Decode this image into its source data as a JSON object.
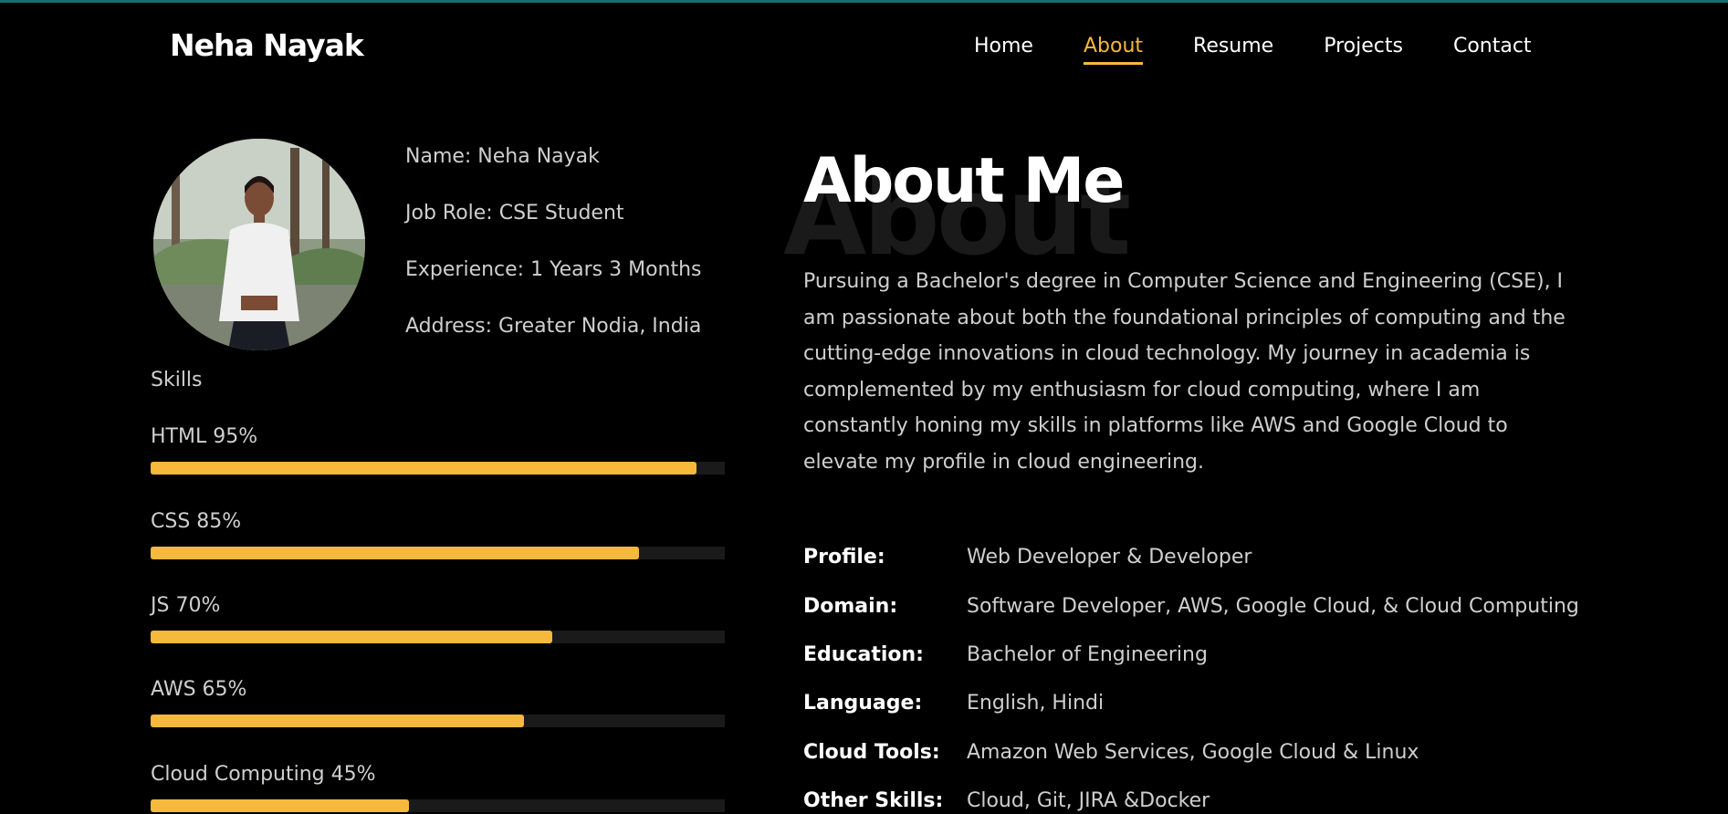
{
  "header": {
    "logo": "Neha Nayak",
    "nav": [
      {
        "label": "Home",
        "active": false
      },
      {
        "label": "About",
        "active": true
      },
      {
        "label": "Resume",
        "active": false
      },
      {
        "label": "Projects",
        "active": false
      },
      {
        "label": "Contact",
        "active": false
      }
    ]
  },
  "colors": {
    "accent": "#f6b93b",
    "background": "#000000",
    "topline": "#12706f",
    "track": "#1a1a1a"
  },
  "profile": {
    "photo_icon": "profile-photo",
    "info": [
      "Name: Neha Nayak",
      "Job Role: CSE Student",
      "Experience: 1 Years 3 Months",
      "Address: Greater Nodia, India"
    ]
  },
  "skills": {
    "title": "Skills",
    "items": [
      {
        "label": "HTML 95%",
        "percent": 95
      },
      {
        "label": "CSS 85%",
        "percent": 85
      },
      {
        "label": "JS 70%",
        "percent": 70
      },
      {
        "label": "AWS 65%",
        "percent": 65
      },
      {
        "label": "Cloud Computing 45%",
        "percent": 45
      }
    ]
  },
  "about": {
    "background_word": "About",
    "title": "About Me",
    "paragraph": "Pursuing a Bachelor's degree in Computer Science and Engineering (CSE), I am passionate about both the foundational principles of computing and the cutting-edge innovations in cloud technology. My journey in academia is complemented by my enthusiasm for cloud computing, where I am constantly honing my skills in platforms like AWS and Google Cloud to elevate my profile in cloud engineering.",
    "details": [
      {
        "key": "Profile:",
        "value": "Web Developer & Developer"
      },
      {
        "key": "Domain:",
        "value": "Software Developer, AWS, Google Cloud, & Cloud Computing"
      },
      {
        "key": "Education:",
        "value": "Bachelor of Engineering"
      },
      {
        "key": "Language:",
        "value": "English, Hindi"
      },
      {
        "key": "Cloud Tools:",
        "value": "Amazon Web Services, Google Cloud & Linux"
      },
      {
        "key": "Other Skills:",
        "value": "Cloud, Git, JIRA &Docker"
      }
    ]
  }
}
